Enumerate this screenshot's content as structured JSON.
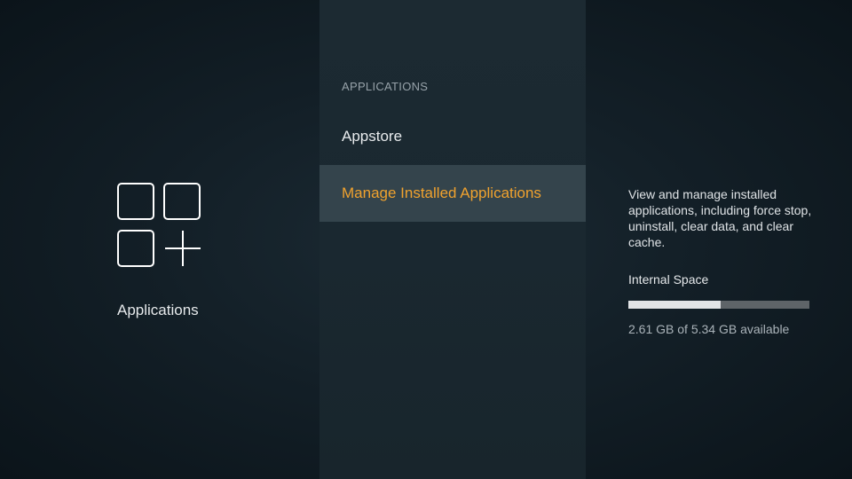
{
  "left": {
    "icon": "applications-grid-plus-icon",
    "section_title": "Applications"
  },
  "menu": {
    "header": "APPLICATIONS",
    "items": [
      {
        "label": "Appstore",
        "selected": false
      },
      {
        "label": "Manage Installed Applications",
        "selected": true
      }
    ]
  },
  "details": {
    "description": "View and manage installed applications, including force stop, uninstall, clear data, and clear cache.",
    "space_title": "Internal Space",
    "used_fraction": 0.51,
    "space_text": "2.61 GB of 5.34 GB available"
  },
  "colors": {
    "accent": "#f0a22e",
    "selected_bg": "#34444c",
    "bar_track": "#5e6468",
    "bar_fill": "#e2e4e6"
  }
}
